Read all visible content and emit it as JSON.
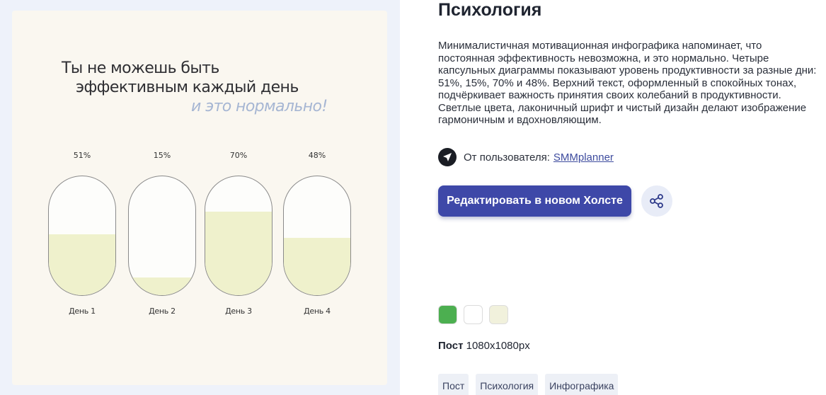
{
  "preview": {
    "headline_line1": "Ты не можешь быть",
    "headline_line2": "эффективным каждый день",
    "headline_line3": "и это нормально!",
    "capsules": [
      {
        "percent_label": "51%",
        "value": 51,
        "day": "День 1"
      },
      {
        "percent_label": "15%",
        "value": 15,
        "day": "День 2"
      },
      {
        "percent_label": "70%",
        "value": 70,
        "day": "День 3"
      },
      {
        "percent_label": "48%",
        "value": 48,
        "day": "День 4"
      }
    ]
  },
  "details": {
    "title": "Психология",
    "description": "Минималистичная мотивационная инфографика напоминает, что постоянная эффективность невозможна, и это нормально. Четыре капсульных диаграммы показывают уровень продуктивности за разные дни: 51%, 15%, 70% и 48%. Верхний текст, оформленный в спокойных тонах, подчёркивает важность принятия своих колебаний в продуктивности. Светлые цвета, лаконичный шрифт и чистый дизайн делают изображение гармоничным и вдохновляющим.",
    "author_label": "От пользователя:",
    "author_name": "SMMplanner",
    "author_icon": "paper-plane-icon",
    "edit_button": "Редактировать в новом Холсте",
    "share_icon": "share-icon",
    "swatches": [
      "#4caf50",
      "#ffffff",
      "#f1f1dc"
    ],
    "format_label": "Пост",
    "format_size": "1080x1080px",
    "tags": [
      "Пост",
      "Психология",
      "Инфографика"
    ]
  }
}
